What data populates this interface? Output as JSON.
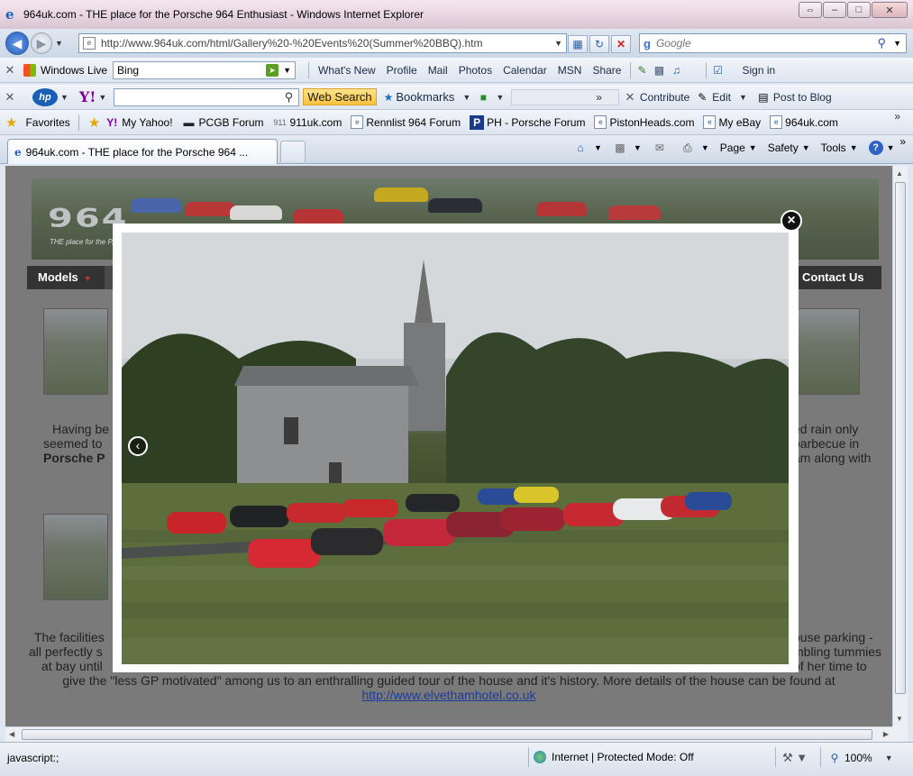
{
  "window": {
    "title": "964uk.com - THE place for the Porsche 964 Enthusiast - Windows Internet Explorer",
    "min": "⇔",
    "restore": "–",
    "max": "□",
    "close": "✕"
  },
  "address": {
    "url": "http://www.964uk.com/html/Gallery%20-%20Events%20(Summer%20BBQ).htm",
    "search_placeholder": "Google"
  },
  "windows_live_bar": {
    "brand": "Windows Live",
    "search_value": "Bing",
    "links": [
      "What's New",
      "Profile",
      "Mail",
      "Photos",
      "Calendar",
      "MSN",
      "Share"
    ],
    "sign_in": "Sign in"
  },
  "yahoo_bar": {
    "hp": "hp",
    "yahoo": "Y!",
    "web_search": "Web Search",
    "bookmarks": "Bookmarks",
    "more": "»",
    "contribute": "Contribute",
    "edit": "Edit",
    "post_to_blog": "Post to Blog"
  },
  "favorites_bar": {
    "label": "Favorites",
    "items": [
      "My Yahoo!",
      "PCGB Forum",
      "911uk.com",
      "Rennlist 964 Forum",
      "PH - Porsche Forum",
      "PistonHeads.com",
      "My eBay",
      "964uk.com"
    ],
    "more": "»"
  },
  "tabs": {
    "active": "964uk.com - THE place for the Porsche 964 ...",
    "more": "»"
  },
  "commands": {
    "page": "Page",
    "safety": "Safety",
    "tools": "Tools",
    "help": "?"
  },
  "site": {
    "logo": "964",
    "tagline": "THE place for the P...",
    "nav_models": "Models",
    "nav_contact": "Contact Us",
    "para1_line1_left": "Having be",
    "para1_line1_right": "ed rain only",
    "para1_line2_left": "seemed to",
    "para1_line2_right": "barbecue in",
    "para1_line3_left": "Porsche P",
    "para1_line3_right": "am along with",
    "para2_line1_left": "The facilities",
    "para2_line1_right": "ouse parking -",
    "para2_line2_left": "all perfectly s",
    "para2_line2_right": "mbling tummies",
    "para2_line3_left": "at bay until",
    "para2_line3_right": "of her time to",
    "para2_line4": "give the \"less GP motivated\" among us to an enthralling guided tour of the house and it's history. More details of the house can be found at",
    "link": "http://www.elvethamhotel.co.uk"
  },
  "lightbox": {
    "prev": "‹",
    "close": "×"
  },
  "status": {
    "text": "javascript:;",
    "zone": "Internet | Protected Mode: Off",
    "zoom": "100%"
  }
}
